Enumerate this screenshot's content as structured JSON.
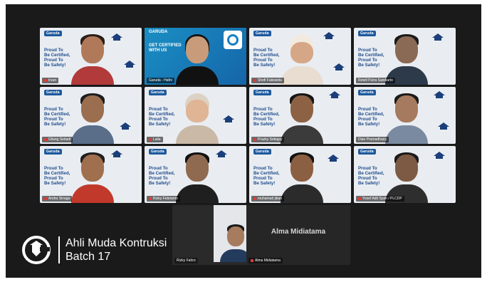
{
  "background_brand": "Garuda",
  "slogan": "Proud To\nBe Certified,\nProud To\nBe Safety!",
  "host_slide": {
    "logo": "GARUDA",
    "cta": "GET CERTIFIED\nWITH US"
  },
  "tiles": [
    {
      "name": "Irvan",
      "active": false
    },
    {
      "name": "Garuda - Hafni",
      "active": true
    },
    {
      "name": "Shofi Fatiswida",
      "active": false
    },
    {
      "name": "Retell Putra Sandiarto",
      "active": false
    },
    {
      "name": "Gilang Setiadi",
      "active": false
    },
    {
      "name": "Laila",
      "active": false
    },
    {
      "name": "Prazky Setiajay",
      "active": false
    },
    {
      "name": "Dian Pramadhany",
      "active": false
    },
    {
      "name": "Andra Sinaga",
      "active": false
    },
    {
      "name": "Rizky Febrianto",
      "active": false
    },
    {
      "name": "muhamad jikan",
      "active": false
    },
    {
      "name": "Yosef Adit Syah / PLCDP",
      "active": false
    }
  ],
  "bottom": {
    "small_tile_name": "Rizky Fahro",
    "blank_tile_title": "Alma Midiatama",
    "blank_tile_name": "Alma Midiatama"
  },
  "caption": {
    "line1": "Ahli Muda Kontruksi",
    "line2": "Batch 17"
  },
  "colors": {
    "frame": "#1a1a1a",
    "active_outline": "#31c48d",
    "slogan": "#1f4b8a",
    "host_blue": "#1565a8"
  },
  "icons": {
    "brand": "garuda-shield-icon",
    "mic": "mic-muted-icon",
    "cap": "graduation-cap-icon"
  }
}
